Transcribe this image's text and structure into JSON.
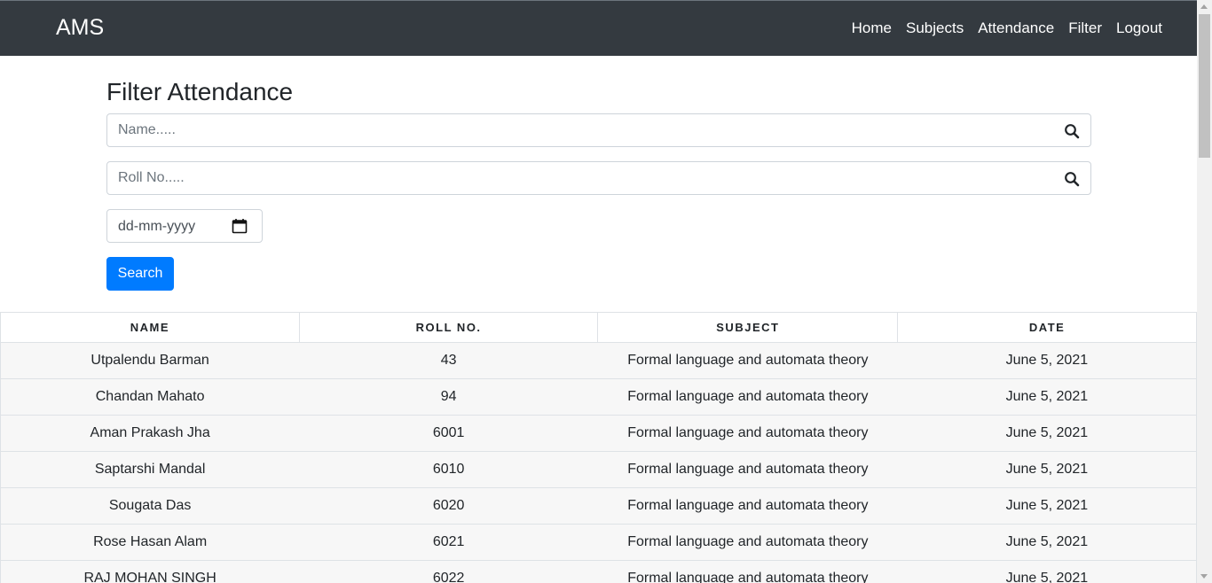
{
  "navbar": {
    "brand": "AMS",
    "links": [
      "Home",
      "Subjects",
      "Attendance",
      "Filter",
      "Logout"
    ]
  },
  "form": {
    "title": "Filter Attendance",
    "name_placeholder": "Name.....",
    "roll_placeholder": "Roll No.....",
    "date_placeholder": "dd-mm-yyyy",
    "search_label": "Search"
  },
  "table": {
    "headers": [
      "Name",
      "Roll No.",
      "Subject",
      "Date"
    ],
    "rows": [
      {
        "name": "Utpalendu Barman",
        "roll": "43",
        "subject": "Formal language and automata theory",
        "date": "June 5, 2021"
      },
      {
        "name": "Chandan Mahato",
        "roll": "94",
        "subject": "Formal language and automata theory",
        "date": "June 5, 2021"
      },
      {
        "name": "Aman Prakash Jha",
        "roll": "6001",
        "subject": "Formal language and automata theory",
        "date": "June 5, 2021"
      },
      {
        "name": "Saptarshi Mandal",
        "roll": "6010",
        "subject": "Formal language and automata theory",
        "date": "June 5, 2021"
      },
      {
        "name": "Sougata Das",
        "roll": "6020",
        "subject": "Formal language and automata theory",
        "date": "June 5, 2021"
      },
      {
        "name": "Rose Hasan Alam",
        "roll": "6021",
        "subject": "Formal language and automata theory",
        "date": "June 5, 2021"
      },
      {
        "name": "RAJ MOHAN SINGH",
        "roll": "6022",
        "subject": "Formal language and automata theory",
        "date": "June 5, 2021"
      }
    ]
  },
  "colors": {
    "navbar": "#343a40",
    "primary": "#007bff",
    "row_bg": "#f7f7f7"
  },
  "icons": {
    "search": "search-icon",
    "calendar": "calendar-icon"
  }
}
